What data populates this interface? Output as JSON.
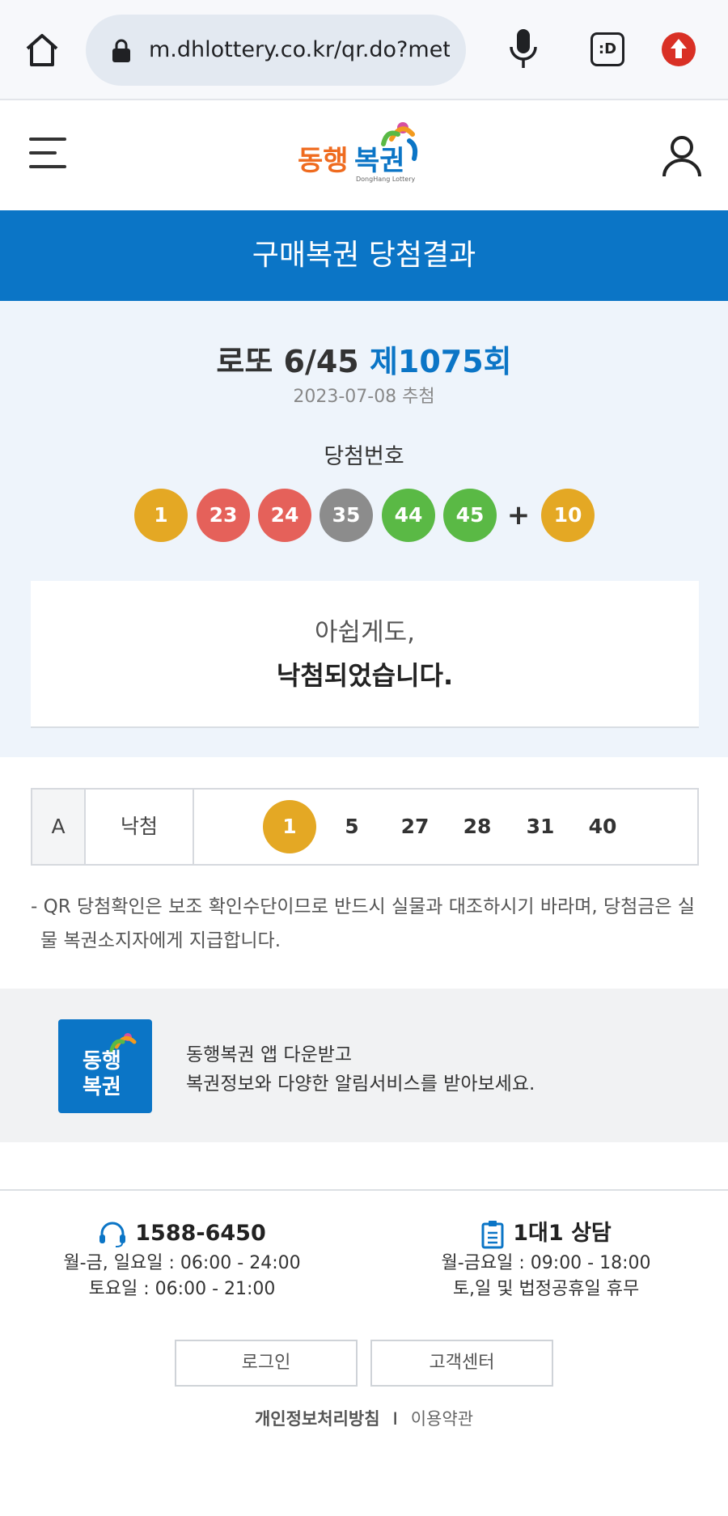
{
  "browser": {
    "url": "m.dhlottery.co.kr/qr.do?method=winQr",
    "tabs_label": ":D",
    "colors": {
      "update_badge": "#d93025"
    },
    "icons": [
      "home-icon",
      "lock-icon",
      "mic-icon",
      "tab-switcher-icon",
      "update-icon"
    ]
  },
  "header": {
    "logo_text": "동행복권",
    "logo_subtext": "DongHang Lottery",
    "icons": [
      "hamburger-menu-icon",
      "user-icon"
    ]
  },
  "page": {
    "title": "구매복권 당첨결과"
  },
  "draw": {
    "game": "로또 6/45",
    "round": "제1075회",
    "date": "2023-07-08 추첨",
    "win_label": "당첨번호",
    "numbers": [
      "1",
      "23",
      "24",
      "35",
      "44",
      "45"
    ],
    "plus": "+",
    "bonus": "10"
  },
  "result_message": {
    "line1": "아쉽게도,",
    "line2": "낙첨되었습니다."
  },
  "ticket": {
    "game_letter": "A",
    "status": "낙첨",
    "numbers": [
      "1",
      "5",
      "27",
      "28",
      "31",
      "40"
    ],
    "matched": [
      "1"
    ]
  },
  "notice": "- QR 당첨확인은 보조 확인수단이므로 반드시 실물과 대조하시기 바라며, 당첨금은 실물 복권소지자에게 지급합니다.",
  "app_banner": {
    "icon_text_1": "동행",
    "icon_text_2": "복권",
    "line1": "동행복권 앱 다운받고",
    "line2": "복권정보와 다양한 알림서비스를 받아보세요."
  },
  "footer": {
    "phone": {
      "number": "1588-6450",
      "hours1": "월-금, 일요일 : 06:00 - 24:00",
      "hours2": "토요일 : 06:00 - 21:00"
    },
    "consult": {
      "label": "1대1 상담",
      "hours1": "월-금요일 : 09:00 - 18:00",
      "hours2": "토,일 및 법정공휴일 휴무"
    },
    "login_button": "로그인",
    "support_button": "고객센터",
    "privacy_link": "개인정보처리방침",
    "separator": "I",
    "terms_link": "이용약관",
    "icons": [
      "headset-icon",
      "clipboard-icon"
    ]
  },
  "ball_colors": {
    "yellow": "#e4a824",
    "red": "#e5615a",
    "gray": "#8c8c8c",
    "green": "#5ab945",
    "brand_blue": "#0b75c6"
  }
}
